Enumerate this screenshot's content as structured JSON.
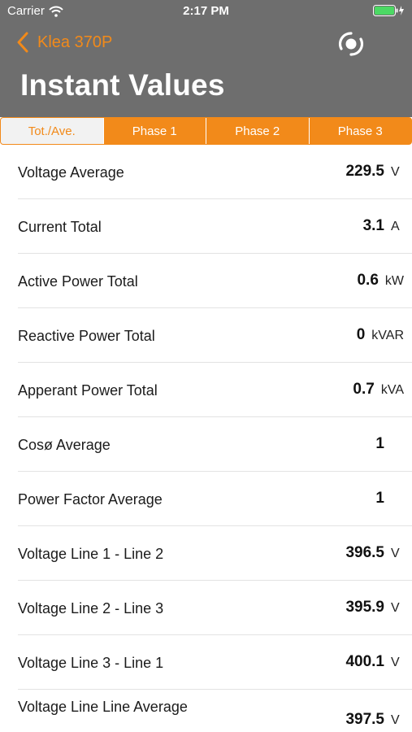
{
  "status_bar": {
    "carrier": "Carrier",
    "time": "2:17 PM"
  },
  "nav": {
    "back_label": "Klea 370P",
    "title": "Instant Values"
  },
  "colors": {
    "accent": "#f28a1a",
    "header_bg": "#6e6e6e",
    "battery": "#4cd964"
  },
  "tabs": [
    {
      "label": "Tot./Ave.",
      "selected": true
    },
    {
      "label": "Phase 1",
      "selected": false
    },
    {
      "label": "Phase 2",
      "selected": false
    },
    {
      "label": "Phase 3",
      "selected": false
    }
  ],
  "rows": [
    {
      "label": "Voltage Average",
      "value": "229.5",
      "unit": "V"
    },
    {
      "label": "Current Total",
      "value": "3.1",
      "unit": "A"
    },
    {
      "label": "Active Power Total",
      "value": "0.6",
      "unit": "kW"
    },
    {
      "label": "Reactive Power Total",
      "value": "0",
      "unit": "kVAR"
    },
    {
      "label": "Apperant Power Total",
      "value": "0.7",
      "unit": "kVA"
    },
    {
      "label": "Cosø Average",
      "value": "1",
      "unit": ""
    },
    {
      "label": "Power Factor Average",
      "value": "1",
      "unit": ""
    },
    {
      "label": "Voltage Line 1 - Line 2",
      "value": "396.5",
      "unit": "V"
    },
    {
      "label": "Voltage Line 2 - Line 3",
      "value": "395.9",
      "unit": "V"
    },
    {
      "label": "Voltage Line 3 - Line 1",
      "value": "400.1",
      "unit": "V"
    },
    {
      "label": "Voltage Line Line Average",
      "value": "397.5",
      "unit": "V"
    }
  ]
}
